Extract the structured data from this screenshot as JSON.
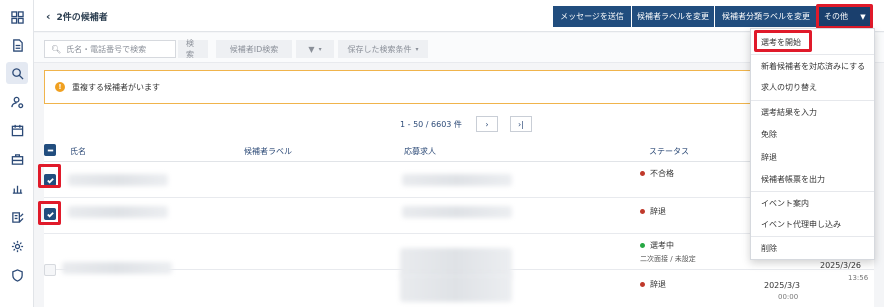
{
  "header": {
    "back_label": "2件の候補者",
    "actions": {
      "send_message": "メッセージを送信",
      "change_label": "候補者ラベルを変更",
      "change_category_label": "候補者分類ラベルを変更",
      "other": "その他"
    }
  },
  "search": {
    "placeholder": "氏名・電話番号で検索",
    "search_button": "検索",
    "id_search_button": "候補者ID検索",
    "saved_conditions": "保存した検索条件"
  },
  "alert": {
    "message": "重複する候補者がいます"
  },
  "pagination": {
    "range": "1 - 50 / 6603 件",
    "next": "›",
    "last": "›|"
  },
  "table": {
    "columns": {
      "name": "氏名",
      "label": "候補者ラベル",
      "job": "応募求人",
      "status": "ステータス"
    },
    "rows": [
      {
        "checked": true,
        "status": "不合格",
        "status_color": "#c0392b",
        "sub": "",
        "date": "",
        "time": ""
      },
      {
        "checked": true,
        "status": "辞退",
        "status_color": "#c0392b",
        "sub": "",
        "date": "",
        "time": ""
      },
      {
        "checked": false,
        "status": "選考中",
        "status_color": "#27a844",
        "sub": "二次面接 / 未設定",
        "date": "2025/3/26",
        "time": "13:56"
      },
      {
        "checked": false,
        "status": "辞退",
        "status_color": "#c0392b",
        "sub": "",
        "date": "2025/3/3",
        "time": "00:00"
      }
    ]
  },
  "menu": {
    "items": [
      "選考を開始",
      "新着候補者を対応済みにする",
      "求人の切り替え",
      "選考結果を入力",
      "免除",
      "辞退",
      "候補者帳票を出力",
      "イベント案内",
      "イベント代理申し込み",
      "削除"
    ]
  },
  "colors": {
    "primary": "#214d7e",
    "highlight": "#e01a2a",
    "alert_border": "#f0b44c"
  }
}
